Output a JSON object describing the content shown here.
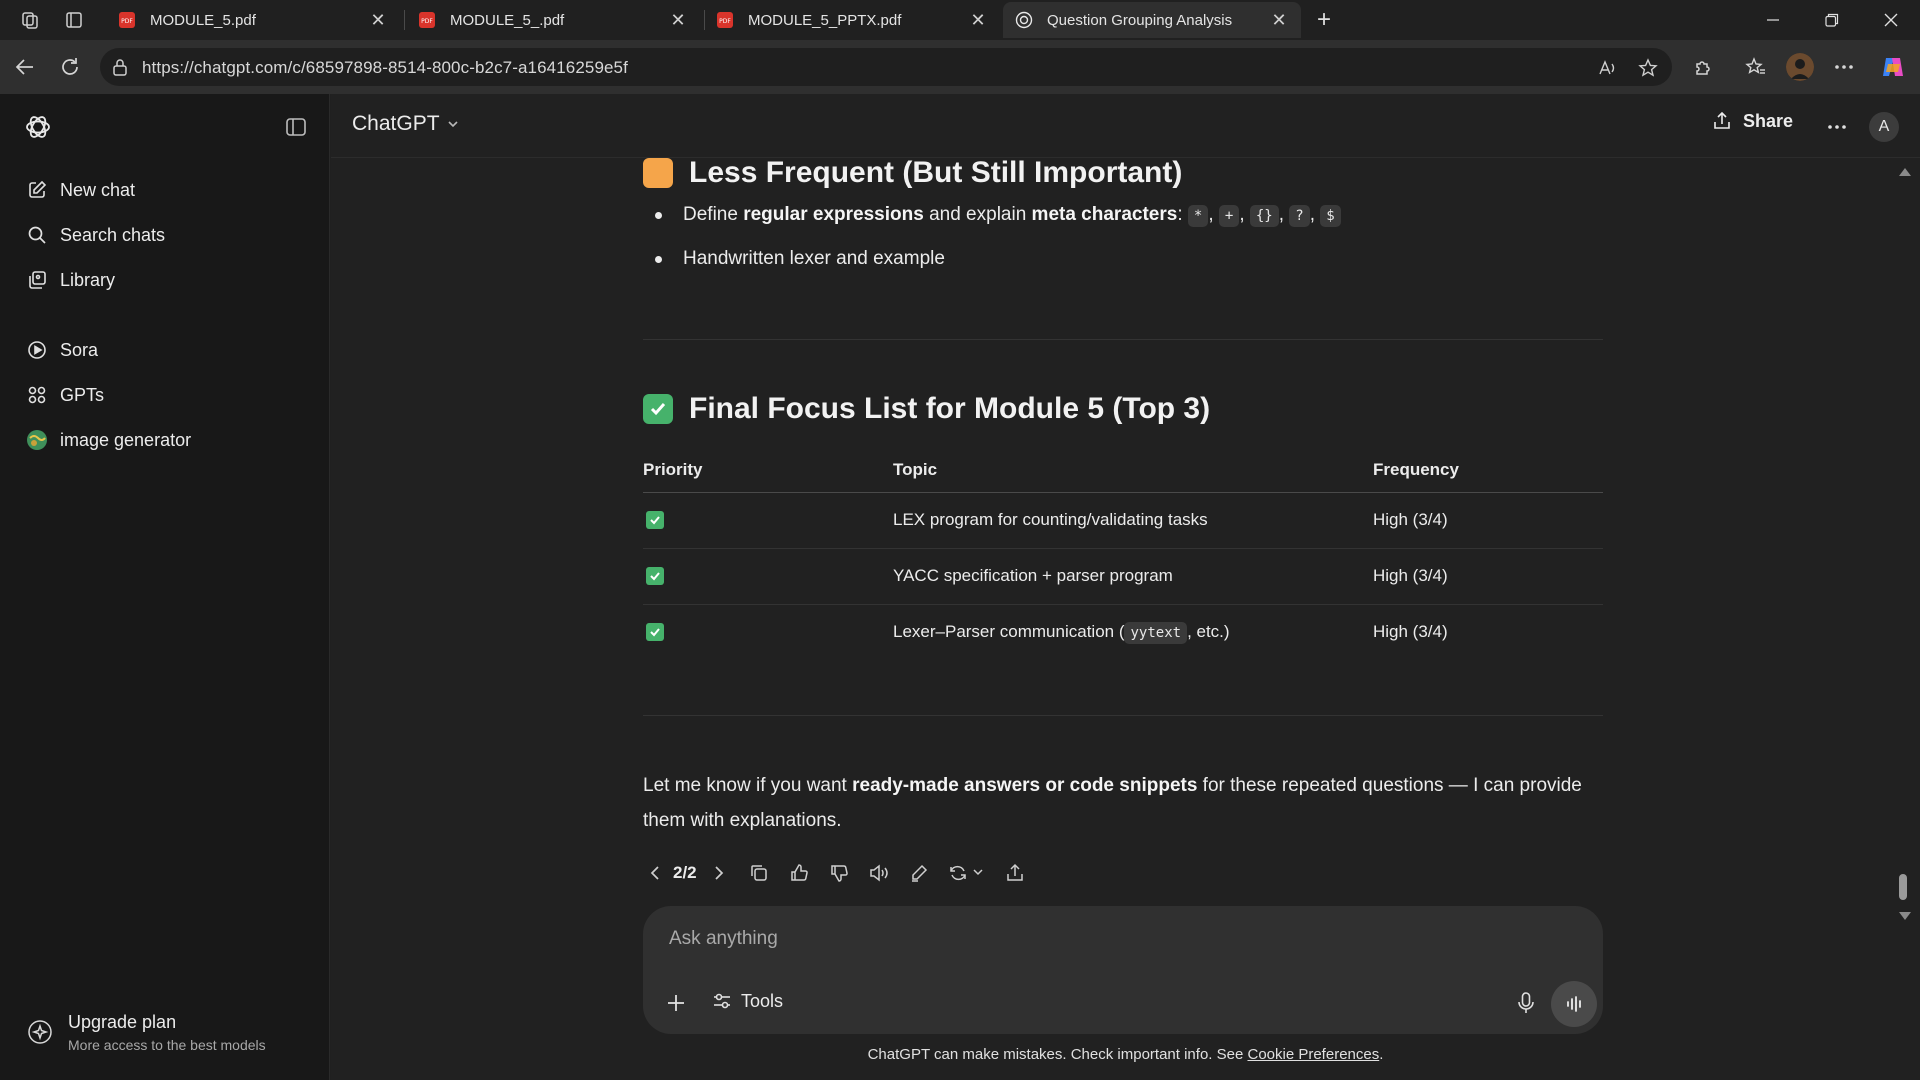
{
  "browser": {
    "tabs": [
      {
        "title": "MODULE_5.pdf",
        "icon": "pdf-icon",
        "active": false
      },
      {
        "title": "MODULE_5_.pdf",
        "icon": "pdf-icon",
        "active": false
      },
      {
        "title": "MODULE_5_PPTX.pdf",
        "icon": "pdf-icon",
        "active": false
      },
      {
        "title": "Question Grouping Analysis",
        "icon": "chatgpt-icon",
        "active": true
      }
    ],
    "url": "https://chatgpt.com/c/68597898-8514-800c-b2c7-a16416259e5f"
  },
  "sidebar": {
    "items": [
      {
        "label": "New chat",
        "icon": "compose-icon"
      },
      {
        "label": "Search chats",
        "icon": "search-icon"
      },
      {
        "label": "Library",
        "icon": "library-icon"
      },
      {
        "label": "Sora",
        "icon": "play-icon"
      },
      {
        "label": "GPTs",
        "icon": "grid-icon"
      },
      {
        "label": "image generator",
        "icon": "globe-avatar-icon"
      }
    ],
    "upgrade": {
      "title": "Upgrade plan",
      "subtitle": "More access to the best models"
    }
  },
  "header": {
    "model": "ChatGPT",
    "share_label": "Share",
    "avatar_letter": "A"
  },
  "message": {
    "section1": {
      "emoji": "orange-square",
      "heading": "Less Frequent (But Still Important)",
      "bullet1": {
        "p1": "Define ",
        "b1": "regular expressions",
        "p2": " and explain ",
        "b2": "meta characters",
        "p3": ": ",
        "codes": [
          "*",
          "+",
          "{}",
          "?",
          "$"
        ],
        "sep": ", "
      },
      "bullet2": "Handwritten lexer and example"
    },
    "section2": {
      "emoji": "check-box",
      "heading": "Final Focus List for Module 5 (Top 3)",
      "table": {
        "headers": [
          "Priority",
          "Topic",
          "Frequency"
        ],
        "rows": [
          {
            "topic": "LEX program for counting/validating tasks",
            "frequency": "High (3/4)"
          },
          {
            "topic": "YACC specification + parser program",
            "frequency": "High (3/4)"
          },
          {
            "topic_pre": "Lexer–Parser communication (",
            "topic_code": "yytext",
            "topic_post": ", etc.)",
            "frequency": "High (3/4)"
          }
        ]
      }
    },
    "closing": {
      "p1": "Let me know if you want ",
      "b1": "ready-made answers or code snippets",
      "p2": " for these repeated questions — I can provide them with explanations."
    },
    "pagination": "2/2"
  },
  "composer": {
    "placeholder": "Ask anything",
    "tools_label": "Tools"
  },
  "footer": {
    "disclaimer": "ChatGPT can make mistakes. Check important info. See ",
    "link": "Cookie Preferences",
    "end": "."
  }
}
